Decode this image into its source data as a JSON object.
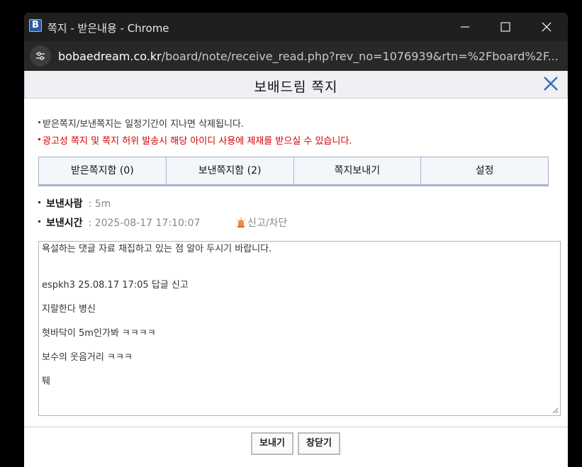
{
  "window": {
    "favicon_letter": "B",
    "title": "쪽지 - 받은내용 - Chrome"
  },
  "address": {
    "host": "bobaedream.co.kr",
    "path": "/board/note/receive_read.php?rev_no=1076939&rtn=%2Fboard%2F..."
  },
  "popup": {
    "title": "보배드림 쪽지"
  },
  "notices": [
    "받은쪽지/보낸쪽지는 일정기간이 지나면 삭제됩니다.",
    "광고성 쪽지 및 쪽지 허위 발송시 해당 아이디 사용에 제재를 받으실 수 있습니다."
  ],
  "tabs": [
    "받은쪽지함 (0)",
    "보낸쪽지함 (2)",
    "쪽지보내기",
    "설정"
  ],
  "meta": {
    "sender_label": "보낸사람",
    "sender_value": ": 5m",
    "time_label": "보낸시간",
    "time_value": ": 2025-08-17 17:10:07",
    "report_label": "신고/차단"
  },
  "message_lines": [
    "욕설하는 댓글 자료 채집하고 있는 점 알아 두시기 바랍니다.",
    "",
    "",
    "espkh3 25.08.17 17:05 답글 신고",
    "",
    "지랄한다 병신",
    "",
    "혓바닥이 5m인가봐 ㅋㅋㅋㅋ",
    "",
    "보수의 웃음거리 ㅋㅋㅋ",
    "",
    "퉤"
  ],
  "buttons": {
    "send": "보내기",
    "close": "창닫기"
  },
  "colors": {
    "titlebar": "#1f1f1f",
    "addressbar": "#282828",
    "warning_red": "#d40000",
    "tab_border": "#aab4c4",
    "close_x_blue": "#3a6fb5"
  }
}
